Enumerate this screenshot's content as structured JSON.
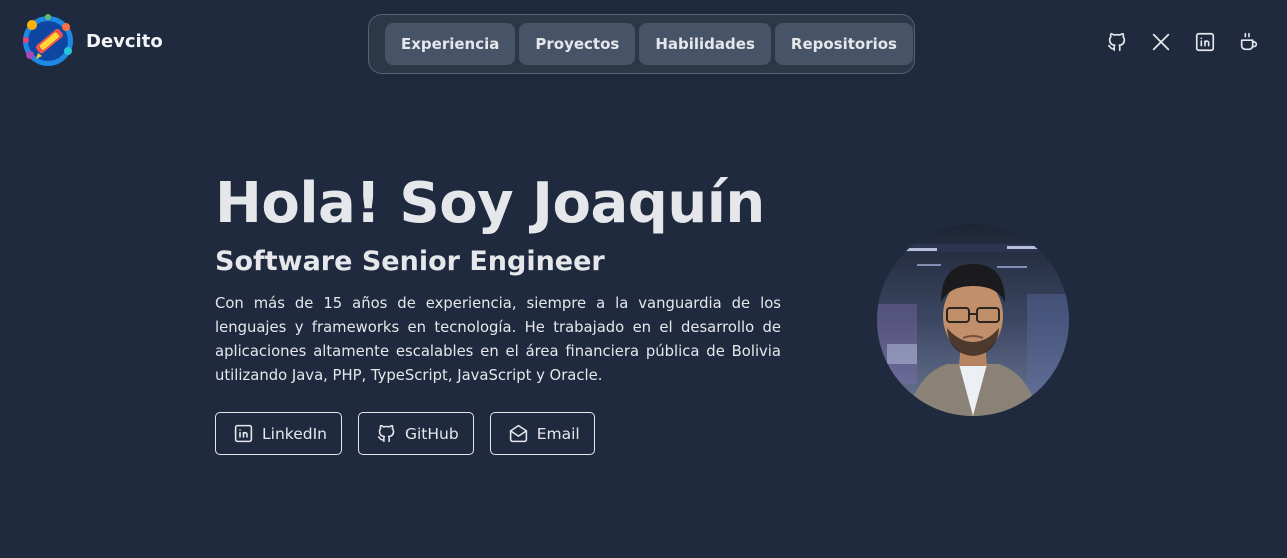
{
  "brand": {
    "name": "Devcito",
    "logo_icon": "devcito-logo-icon"
  },
  "nav": {
    "items": [
      {
        "label": "Experiencia"
      },
      {
        "label": "Proyectos"
      },
      {
        "label": "Habilidades"
      },
      {
        "label": "Repositorios"
      }
    ]
  },
  "social": {
    "icons": [
      "github-icon",
      "x-icon",
      "linkedin-icon",
      "coffee-icon"
    ]
  },
  "hero": {
    "title": "Hola! Soy Joaquín",
    "subtitle": "Software Senior Engineer",
    "description": "Con más de 15 años de experiencia, siempre a la vanguardia de los lenguajes y frameworks en tecnología. He trabajado en el desarrollo de aplicaciones altamente escalables en el área financiera pública de Bolivia utilizando Java, PHP, TypeScript, JavaScript y Oracle.",
    "buttons": [
      {
        "label": "LinkedIn",
        "icon": "linkedin-icon"
      },
      {
        "label": "GitHub",
        "icon": "github-icon"
      },
      {
        "label": "Email",
        "icon": "mail-icon"
      }
    ]
  },
  "colors": {
    "background": "#1f2a3f",
    "nav_button": "#475366",
    "text": "#e5e7eb"
  }
}
